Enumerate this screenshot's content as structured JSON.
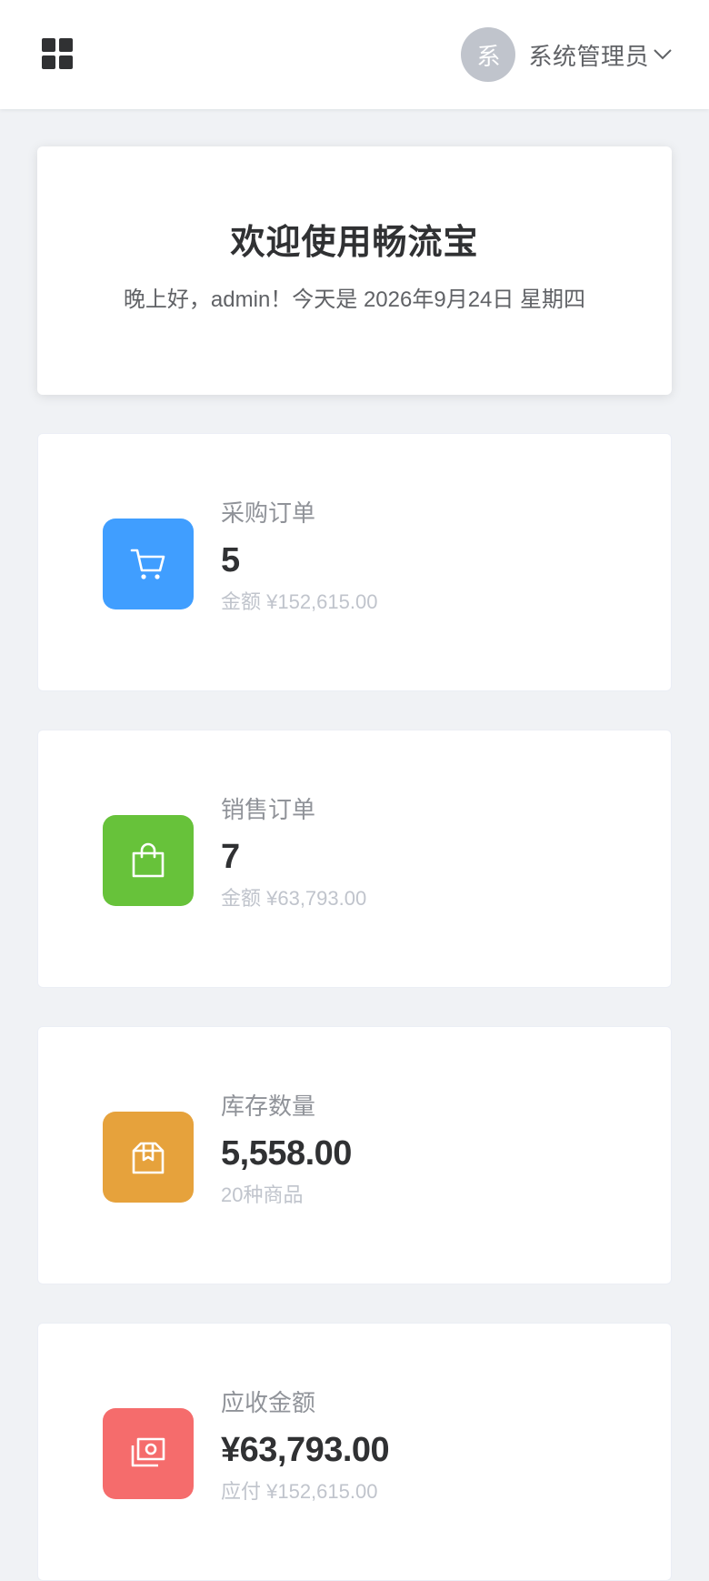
{
  "header": {
    "menu_icon": "grid-menu-icon",
    "avatar_text": "系",
    "user_name": "系统管理员",
    "caret_icon": "chevron-down-icon"
  },
  "welcome": {
    "title": "欢迎使用畅流宝",
    "greeting": "晚上好，admin！今天是 2026年9月24日 星期四"
  },
  "stats": [
    {
      "label": "采购订单",
      "value": "5",
      "sub": "金额 ¥152,615.00",
      "icon": "shopping-cart-icon",
      "color": "#409eff"
    },
    {
      "label": "销售订单",
      "value": "7",
      "sub": "金额 ¥63,793.00",
      "icon": "shopping-bag-icon",
      "color": "#67c23a"
    },
    {
      "label": "库存数量",
      "value": "5,558.00",
      "sub": "20种商品",
      "icon": "box-icon",
      "color": "#e6a23c"
    },
    {
      "label": "应收金额",
      "value": "¥63,793.00",
      "sub": "应付 ¥152,615.00",
      "icon": "money-icon",
      "color": "#f56c6c"
    }
  ]
}
